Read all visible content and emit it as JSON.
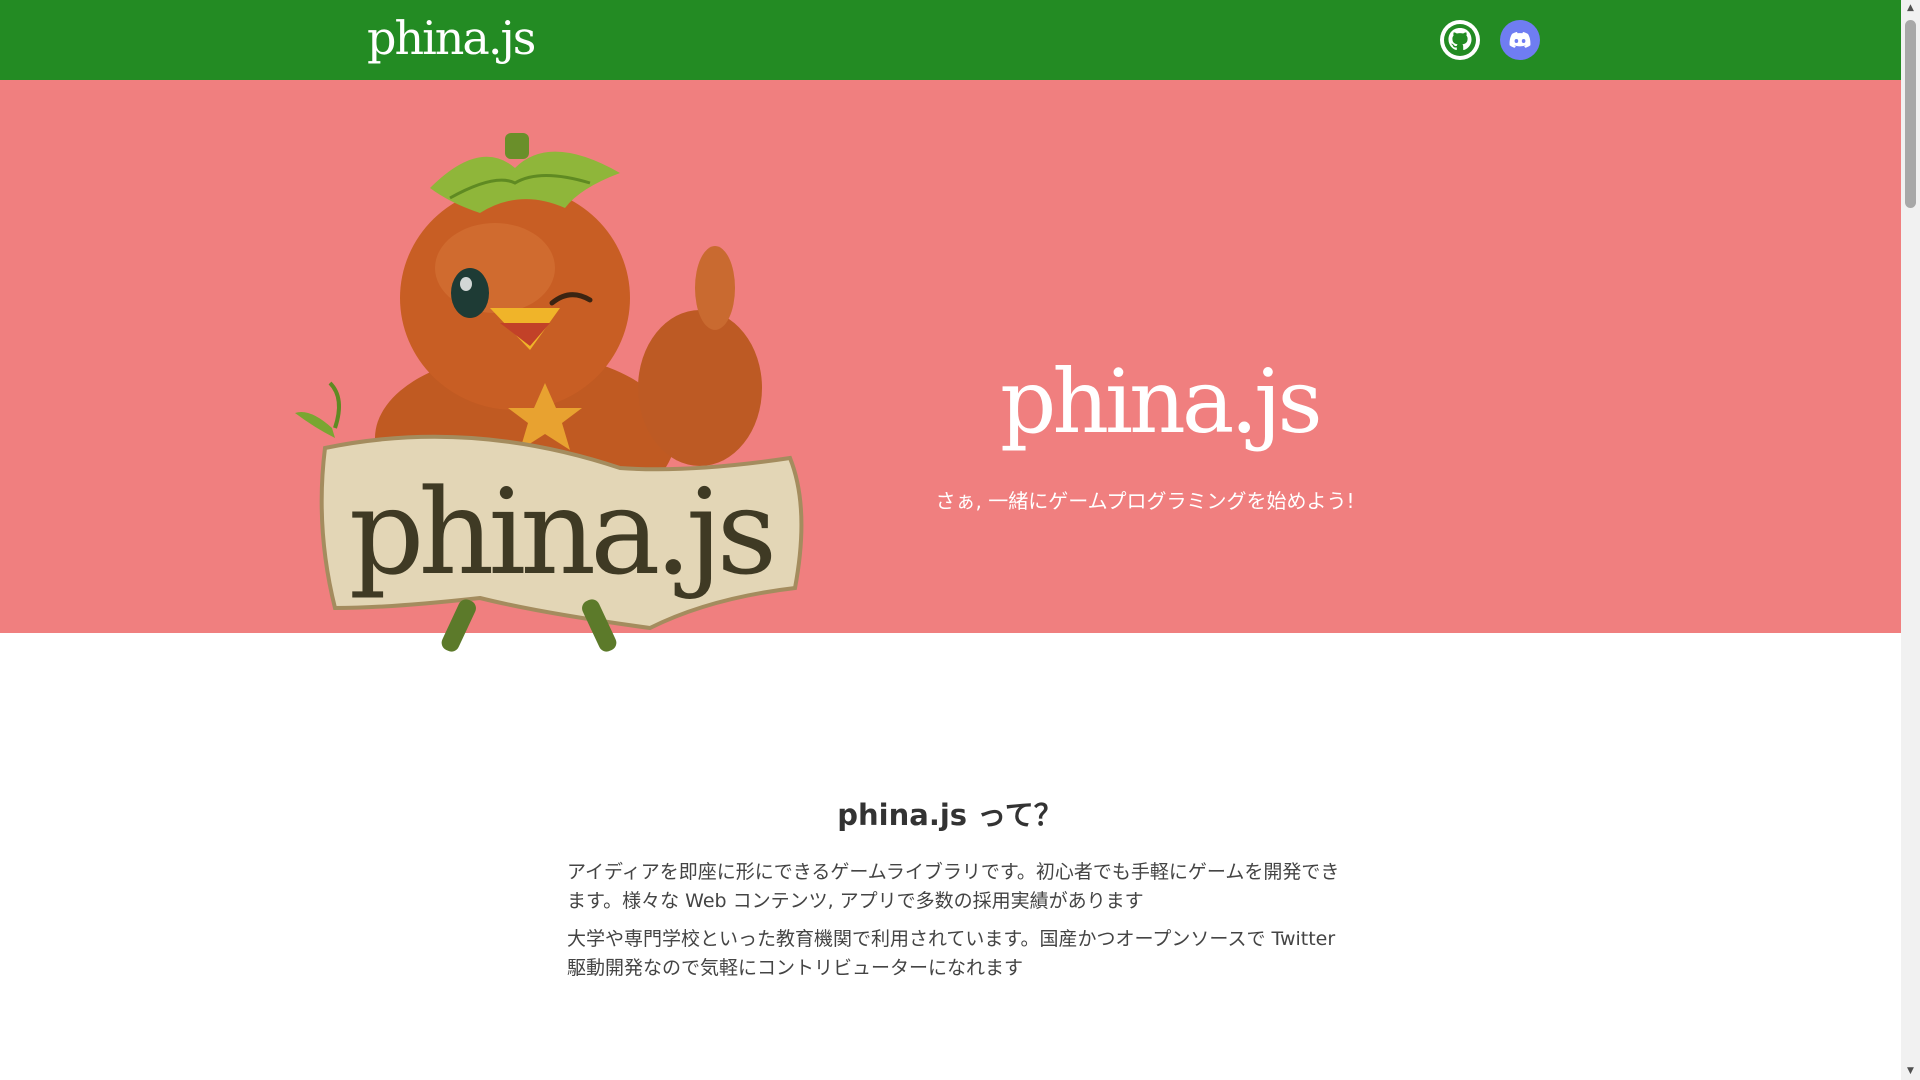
{
  "header": {
    "logo": "phina.js",
    "links": [
      {
        "name": "github",
        "icon": "github-icon"
      },
      {
        "name": "discord",
        "icon": "discord-icon"
      }
    ],
    "background": "#238b23"
  },
  "hero": {
    "title": "phina.js",
    "tagline": "さぁ, 一緒にゲームプログラミングを始めよう!",
    "sign_text": "phina.js",
    "background": "#f07f7f"
  },
  "about": {
    "heading": "phina.js って？",
    "paragraphs": [
      "アイディアを即座に形にできるゲームライブラリです。初心者でも手軽にゲームを開発できます。様々な Web コンテンツ, アプリで多数の採用実績があります",
      "大学や専門学校といった教育機関で利用されています。国産かつオープンソースで Twitter 駆動開発なので気軽にコントリビューターになれます"
    ]
  },
  "colors": {
    "header": "#238b23",
    "hero": "#f07f7f",
    "text": "#333333",
    "discord": "#6f7df2"
  }
}
